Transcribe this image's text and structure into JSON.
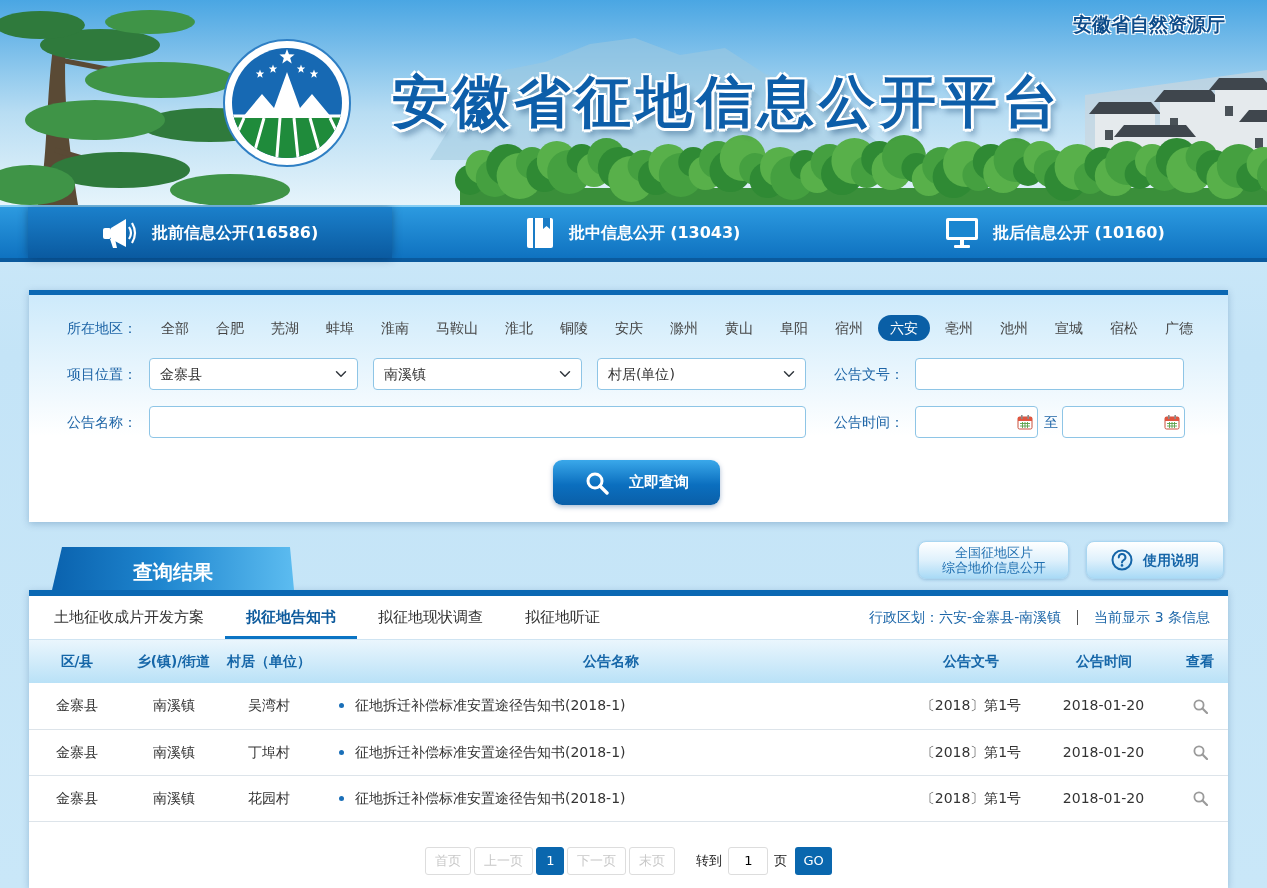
{
  "header": {
    "agency": "安徽省自然资源厅",
    "title": "安徽省征地信息公开平台"
  },
  "nav": [
    {
      "label": "批前信息公开(16586)",
      "selected": true
    },
    {
      "label": "批中信息公开 (13043)",
      "selected": false
    },
    {
      "label": "批后信息公开 (10160)",
      "selected": false
    }
  ],
  "filters": {
    "region_label": "所在地区：",
    "regions": [
      {
        "label": "全部",
        "selected": false
      },
      {
        "label": "合肥",
        "selected": false
      },
      {
        "label": "芜湖",
        "selected": false
      },
      {
        "label": "蚌埠",
        "selected": false
      },
      {
        "label": "淮南",
        "selected": false
      },
      {
        "label": "马鞍山",
        "selected": false
      },
      {
        "label": "淮北",
        "selected": false
      },
      {
        "label": "铜陵",
        "selected": false
      },
      {
        "label": "安庆",
        "selected": false
      },
      {
        "label": "滁州",
        "selected": false
      },
      {
        "label": "黄山",
        "selected": false
      },
      {
        "label": "阜阳",
        "selected": false
      },
      {
        "label": "宿州",
        "selected": false
      },
      {
        "label": "六安",
        "selected": true
      },
      {
        "label": "亳州",
        "selected": false
      },
      {
        "label": "池州",
        "selected": false
      },
      {
        "label": "宣城",
        "selected": false
      },
      {
        "label": "宿松",
        "selected": false
      },
      {
        "label": "广德",
        "selected": false
      }
    ],
    "location_label": "项目位置：",
    "selects": [
      {
        "value": "金寨县"
      },
      {
        "value": "南溪镇"
      },
      {
        "value": "村居(单位)"
      }
    ],
    "doc_number_label": "公告文号：",
    "name_label": "公告名称：",
    "time_label": "公告时间：",
    "time_separator": "至",
    "search_button": "立即查询"
  },
  "results": {
    "title": "查询结果",
    "map_button": {
      "lines": [
        "全国征地区片",
        "综合地价信息公开"
      ]
    },
    "help_button": "使用说明",
    "tabs": [
      {
        "label": "土地征收成片开发方案",
        "selected": false
      },
      {
        "label": "拟征地告知书",
        "selected": true
      },
      {
        "label": "拟征地现状调查",
        "selected": false
      },
      {
        "label": "拟征地听证",
        "selected": false
      }
    ],
    "region_path": "行政区划：六安-金寨县-南溪镇",
    "count": "当前显示 3 条信息"
  },
  "table": {
    "columns": [
      "区/县",
      "乡(镇)/街道",
      "村居（单位）",
      "公告名称",
      "公告文号",
      "公告时间",
      "查看"
    ],
    "rows": [
      {
        "cells": [
          "金寨县",
          "南溪镇",
          "吴湾村",
          "征地拆迁补偿标准安置途径告知书(2018-1)",
          "〔2018〕第1号",
          "2018-01-20"
        ]
      },
      {
        "cells": [
          "金寨县",
          "南溪镇",
          "丁埠村",
          "征地拆迁补偿标准安置途径告知书(2018-1)",
          "〔2018〕第1号",
          "2018-01-20"
        ]
      },
      {
        "cells": [
          "金寨县",
          "南溪镇",
          "花园村",
          "征地拆迁补偿标准安置途径告知书(2018-1)",
          "〔2018〕第1号",
          "2018-01-20"
        ]
      }
    ]
  },
  "pager": {
    "buttons": [
      {
        "label": "首页",
        "disabled": true,
        "selected": false
      },
      {
        "label": "上一页",
        "disabled": true,
        "selected": false
      },
      {
        "label": "1",
        "disabled": false,
        "selected": true
      },
      {
        "label": "下一页",
        "disabled": true,
        "selected": false
      },
      {
        "label": "末页",
        "disabled": true,
        "selected": false
      }
    ],
    "goto_label": "转到",
    "goto_value": "1",
    "page_unit": "页",
    "go_button": "GO"
  }
}
